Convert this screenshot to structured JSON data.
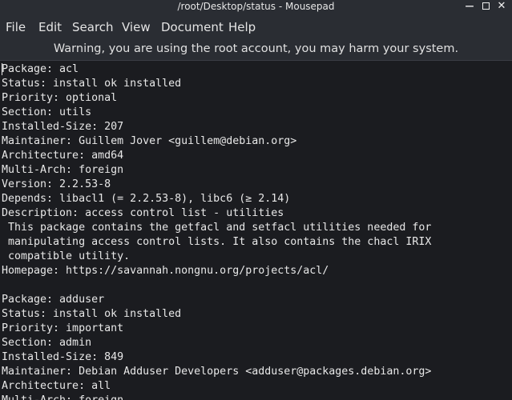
{
  "window": {
    "title": "/root/Desktop/status - Mousepad",
    "minimize_glyph": "—",
    "close_glyph": "✕"
  },
  "menu": {
    "items": [
      "File",
      "Edit",
      "Search",
      "View",
      "Document",
      "Help"
    ]
  },
  "warning": {
    "text": "Warning, you are using the root account, you may harm your system."
  },
  "editor": {
    "lines": [
      "Package: acl",
      "Status: install ok installed",
      "Priority: optional",
      "Section: utils",
      "Installed-Size: 207",
      "Maintainer: Guillem Jover <guillem@debian.org>",
      "Architecture: amd64",
      "Multi-Arch: foreign",
      "Version: 2.2.53-8",
      "Depends: libacl1 (= 2.2.53-8), libc6 (≥ 2.14)",
      "Description: access control list - utilities",
      " This package contains the getfacl and setfacl utilities needed for",
      " manipulating access control lists. It also contains the chacl IRIX",
      " compatible utility.",
      "Homepage: https://savannah.nongnu.org/projects/acl/",
      "",
      "Package: adduser",
      "Status: install ok installed",
      "Priority: important",
      "Section: admin",
      "Installed-Size: 849",
      "Maintainer: Debian Adduser Developers <adduser@packages.debian.org>",
      "Architecture: all",
      "Multi-Arch: foreign"
    ]
  },
  "colors": {
    "chrome": "#2a2d33",
    "editor_bg": "#1b1c20",
    "text": "#e8e8e8"
  }
}
